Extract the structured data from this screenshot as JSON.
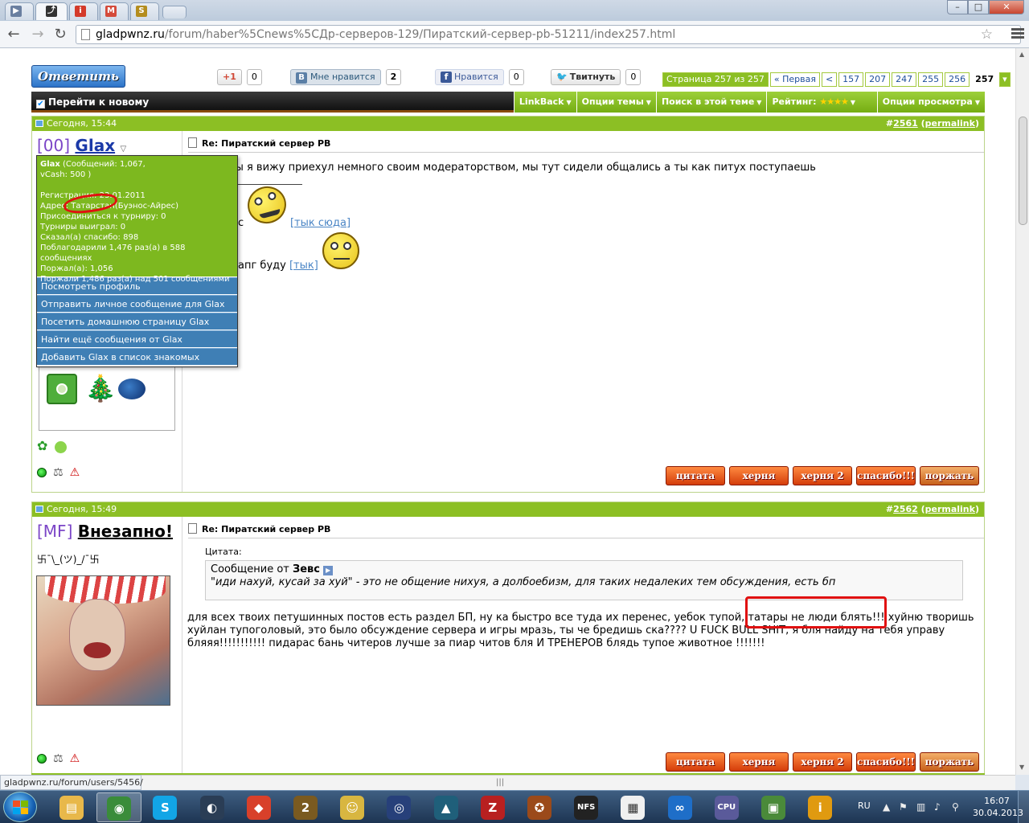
{
  "browser": {
    "url_host": "gladpwnz.ru",
    "url_path": "/forum/haber%5Cnews%5CДр-серверов-129/Пиратский-сервер-pb-51211/index257.html",
    "tabs": [
      {
        "icon": "▶",
        "color": "#6a7fa0"
      },
      {
        "icon": "⤴",
        "color": "#333333"
      },
      {
        "icon": "i",
        "color": "#d43a2a"
      },
      {
        "icon": "M",
        "color": "#d44a3a"
      },
      {
        "icon": "S",
        "color": "#b48d1e"
      }
    ],
    "window_buttons": {
      "minimize": "–",
      "maximize": "□",
      "close": "✕"
    }
  },
  "toolbar": {
    "reply_label": "Ответить",
    "gplus": {
      "label": "+1",
      "count": "0"
    },
    "vk": {
      "logo": "B",
      "label": "Мне нравится",
      "count": "2"
    },
    "fb": {
      "logo": "f",
      "label": "Нравится",
      "count": "0"
    },
    "tw": {
      "logo": "🐦",
      "label": "Твитнуть",
      "count": "0"
    }
  },
  "pagination": {
    "info": "Страница 257 из 257",
    "first": "« Первая",
    "prev": "<",
    "pages": [
      "157",
      "207",
      "247",
      "255",
      "256"
    ],
    "current": "257",
    "menu_arrow": "▾"
  },
  "threadbar": {
    "goto_new": "Перейти к новому",
    "checkbox": "✔",
    "items": [
      "LinkBack",
      "Опции темы",
      "Поиск в этой теме",
      "Рейтинг:",
      "Опции просмотра"
    ],
    "rating_stars": "★★★★"
  },
  "posts": [
    {
      "time": "Сегодня, 15:44",
      "number_hash": "#",
      "number": "2561",
      "permalink": "permalink",
      "clan": "[00]",
      "username": "Glax",
      "title": "Re: Пиратский сервер PB",
      "line1": "ты я вижу приехул немного своим модераторством, мы тут сидели общались а ты как питух поступаешь",
      "line2_tail": "с",
      "link1": "[тык сюда]",
      "line3_tail": "апг буду",
      "link2": "[тык]",
      "buttons": [
        "цитата",
        "херня",
        "херня 2",
        "спасибо!!!",
        "поржать"
      ],
      "popup": {
        "name": "Glax",
        "stats": "(Сообщений: 1,067,",
        "vcash": "vCash: 500 )",
        "lines": [
          "Регистрация: 23.01.2011",
          "Адрес: Татарстан(Буэнос-Айрес)",
          "Присоединиться к турниру: 0",
          "Турниры выиграл: 0",
          "Сказал(а) спасибо: 898",
          "Поблагодарили 1,476 раз(а) в 588 сообщениях",
          "Поржал(а): 1,056",
          "Поржали 1,486 раз(а) над 501 сообщениями"
        ],
        "menu": [
          "Посмотреть профиль",
          "Отправить личное сообщение для Glax",
          "Посетить домашнюю страницу Glax",
          "Найти ещё сообщения от Glax",
          "Добавить Glax в список знакомых"
        ]
      }
    },
    {
      "time": "Сегодня, 15:49",
      "number_hash": "#",
      "number": "2562",
      "permalink": "permalink",
      "clan": "[MF]",
      "username": "Внезапно!",
      "user_title": "卐¯\\_(ツ)_/¯卐",
      "title": "Re: Пиратский сервер PB",
      "quote_label": "Цитата:",
      "quote_from_prefix": "Сообщение от ",
      "quote_author": "Зевс",
      "quote_text": "\"иди нахуй, кусай за хуй\" - это не общение нихуя, а долбоебизм, для таких недалеких тем обсуждения, есть бп",
      "body_line1": "для всех твоих петушинных постов есть раздел БП, ну ка быстро все туда их перенес, уебок тупой, татары не люди блять!!! хуйню творишь",
      "body_line2": "хуйлан тупоголовый, это было обсуждение сервера и игры мразь, ты че бредишь ска???? U FUCK BULL SHIT, я бля найду на тебя управу",
      "body_line3": "бляяя!!!!!!!!!!! пидарас бань читеров лучше за пиар читов бля И ТРЕНЕРОВ блядь тупое животное !!!!!!!",
      "buttons": [
        "цитата",
        "херня",
        "херня 2",
        "спасибо!!!",
        "поржать"
      ]
    }
  ],
  "status_url": "gladpwnz.ru/forum/users/5456/",
  "taskbar": {
    "apps": [
      {
        "name": "explorer",
        "glyph": "▤",
        "color": "#e8b84a"
      },
      {
        "name": "chrome",
        "glyph": "◉",
        "color": "#3a8c3a"
      },
      {
        "name": "skype",
        "glyph": "S",
        "color": "#12a5e6"
      },
      {
        "name": "steam",
        "glyph": "◐",
        "color": "#2a3d55"
      },
      {
        "name": "app-5",
        "glyph": "◆",
        "color": "#d8402a"
      },
      {
        "name": "app-6",
        "glyph": "2",
        "color": "#7a5a20"
      },
      {
        "name": "fallout",
        "glyph": "☺",
        "color": "#d8b640"
      },
      {
        "name": "app-8",
        "glyph": "◎",
        "color": "#27407a"
      },
      {
        "name": "app-9",
        "glyph": "▲",
        "color": "#1f5f7a"
      },
      {
        "name": "app-10",
        "glyph": "Z",
        "color": "#b82020"
      },
      {
        "name": "app-11",
        "glyph": "✪",
        "color": "#9b4a1a"
      },
      {
        "name": "nfs",
        "glyph": "NFS",
        "color": "#222222"
      },
      {
        "name": "app-13",
        "glyph": "▦",
        "color": "#f0f0f0"
      },
      {
        "name": "app-14",
        "glyph": "∞",
        "color": "#1e6ec8"
      },
      {
        "name": "cpu-z",
        "glyph": "CPU",
        "color": "#5a5a9a"
      },
      {
        "name": "app-16",
        "glyph": "▣",
        "color": "#4a8a3a"
      },
      {
        "name": "app-17",
        "glyph": "i",
        "color": "#e09a10"
      }
    ],
    "lang": "RU",
    "time": "16:07",
    "date": "30.04.2013"
  }
}
